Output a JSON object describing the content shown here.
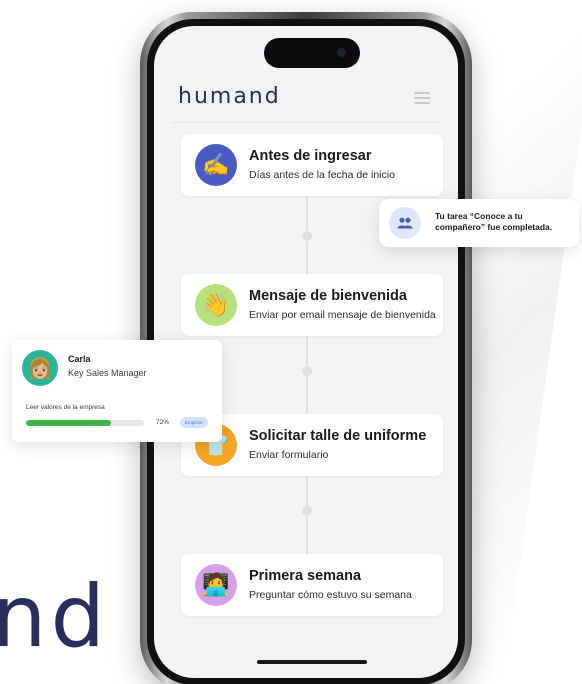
{
  "app": {
    "logo_text": "humand",
    "brand_fragment": "nd",
    "brand_color": "#27305c",
    "menu_icon": "hamburger-icon"
  },
  "steps": [
    {
      "title": "Antes de ingresar",
      "subtitle": "Días antes de la fecha de inicio",
      "icon": "writing-hand-emoji",
      "icon_bg": "#4b59c4",
      "glyph": "✍️"
    },
    {
      "title": "Mensaje de bienvenida",
      "subtitle": "Enviar por email mensaje de bienvenida",
      "icon": "waving-hand-emoji",
      "icon_bg": "#b5e07a",
      "glyph": "👋"
    },
    {
      "title": "Solicitar talle de uniforme",
      "subtitle": "Enviar formulario",
      "icon": "uniform-emoji",
      "icon_bg": "#f5a623",
      "glyph": "👕"
    },
    {
      "title": "Primera semana",
      "subtitle": "Preguntar cómo estuvo su semana",
      "icon": "person-laptop-emoji",
      "icon_bg": "#d6a0e8",
      "glyph": "🧑‍💻"
    }
  ],
  "notification": {
    "icon": "people-icon",
    "text": "Tu tarea “Conoce a tu compañero” fue completada."
  },
  "profile": {
    "name": "Carla",
    "role": "Key Sales Manager",
    "avatar": "woman-avatar-emoji",
    "task_label": "Leer valores de la empresa",
    "progress": 0.72,
    "progress_text": "72%",
    "badge_text": "Empezar"
  }
}
